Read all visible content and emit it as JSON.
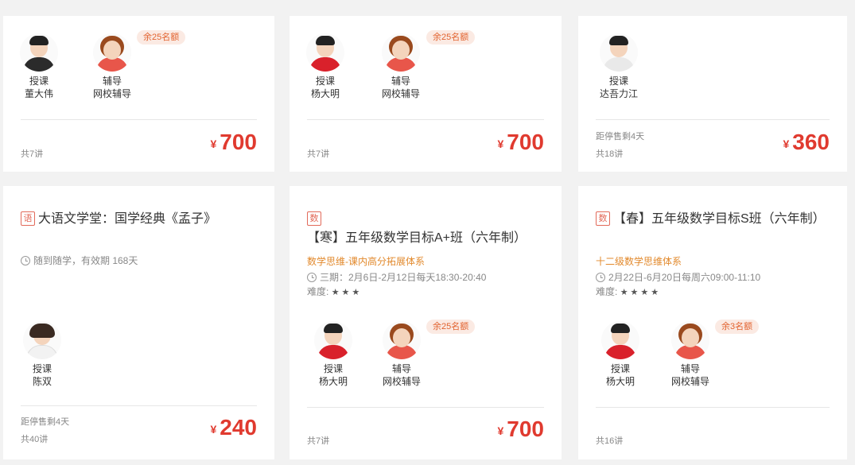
{
  "cards": [
    {
      "teacher": {
        "role": "授课",
        "name": "董大伟"
      },
      "tutor": {
        "role": "辅导",
        "name": "网校辅导"
      },
      "quota": "余25名额",
      "lessons": "共7讲",
      "currency": "¥",
      "price": "700"
    },
    {
      "teacher": {
        "role": "授课",
        "name": "杨大明"
      },
      "tutor": {
        "role": "辅导",
        "name": "网校辅导"
      },
      "quota": "余25名额",
      "lessons": "共7讲",
      "currency": "¥",
      "price": "700"
    },
    {
      "teacher": {
        "role": "授课",
        "name": "达吾力江"
      },
      "deadline": "距停售剩4天",
      "lessons": "共18讲",
      "currency": "¥",
      "price": "360"
    },
    {
      "badge": "语",
      "title": "大语文学堂：国学经典《孟子》",
      "schedule": "随到随学，有效期 168天",
      "teacher": {
        "role": "授课",
        "name": "陈双"
      },
      "deadline": "距停售剩4天",
      "lessons": "共40讲",
      "currency": "¥",
      "price": "240"
    },
    {
      "badge": "数",
      "title": "【寒】五年级数学目标A+班（六年制）",
      "subject": "数学思维-课内高分拓展体系",
      "schedule": "三期：2月6日-2月12日每天18:30-20:40",
      "difficulty_label": "难度:",
      "difficulty_stars": "★★★",
      "teacher": {
        "role": "授课",
        "name": "杨大明"
      },
      "tutor": {
        "role": "辅导",
        "name": "网校辅导"
      },
      "quota": "余25名额",
      "lessons": "共7讲",
      "currency": "¥",
      "price": "700"
    },
    {
      "badge": "数",
      "title": "【春】五年级数学目标S班（六年制）",
      "subject": "十二级数学思维体系",
      "schedule": "2月22日-6月20日每周六09:00-11:10",
      "difficulty_label": "难度:",
      "difficulty_stars": "★★★★",
      "teacher": {
        "role": "授课",
        "name": "杨大明"
      },
      "tutor": {
        "role": "辅导",
        "name": "网校辅导"
      },
      "quota": "余3名额",
      "lessons": "共16讲"
    }
  ],
  "colors": {
    "price": "#e03a2f",
    "quota_text": "#e2632f",
    "subject": "#e2892c",
    "badge": "#e26a5a"
  }
}
